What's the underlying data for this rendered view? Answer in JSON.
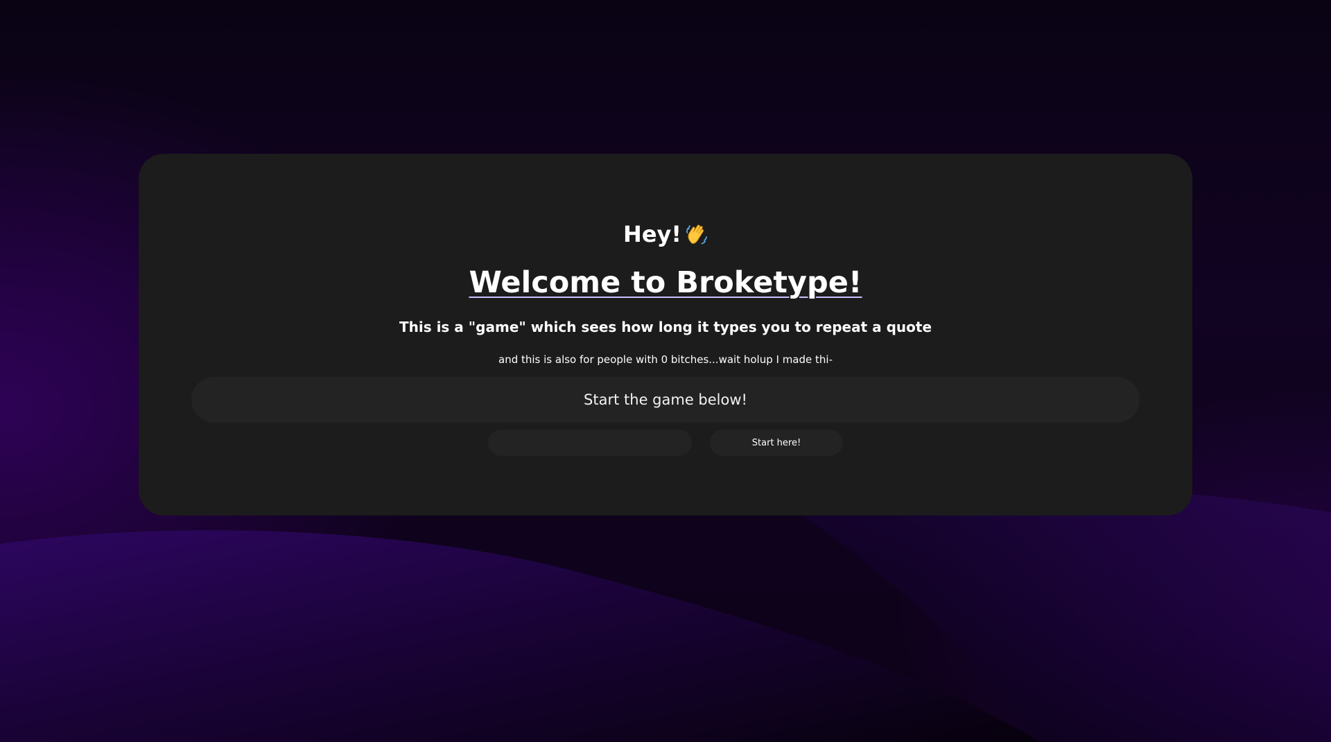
{
  "page": {
    "colors": {
      "background_dark": "#0a0314",
      "background_purple": "#2a0a55",
      "card": "#1c1c1c",
      "control": "#232323",
      "text": "#ffffff",
      "title_underline": "#c9c2ff"
    }
  },
  "card": {
    "greeting": "Hey!",
    "greeting_icon": "waving-hand-icon",
    "title": "Welcome to Broketype!",
    "subtitle": "This is a \"game\" which sees how long it types you to repeat a quote",
    "note": "and this is also for people with 0 bitches...wait holup I made thi-",
    "banner": "Start the game below!",
    "input": {
      "value": "",
      "placeholder": ""
    },
    "start_button_label": "Start here!"
  }
}
